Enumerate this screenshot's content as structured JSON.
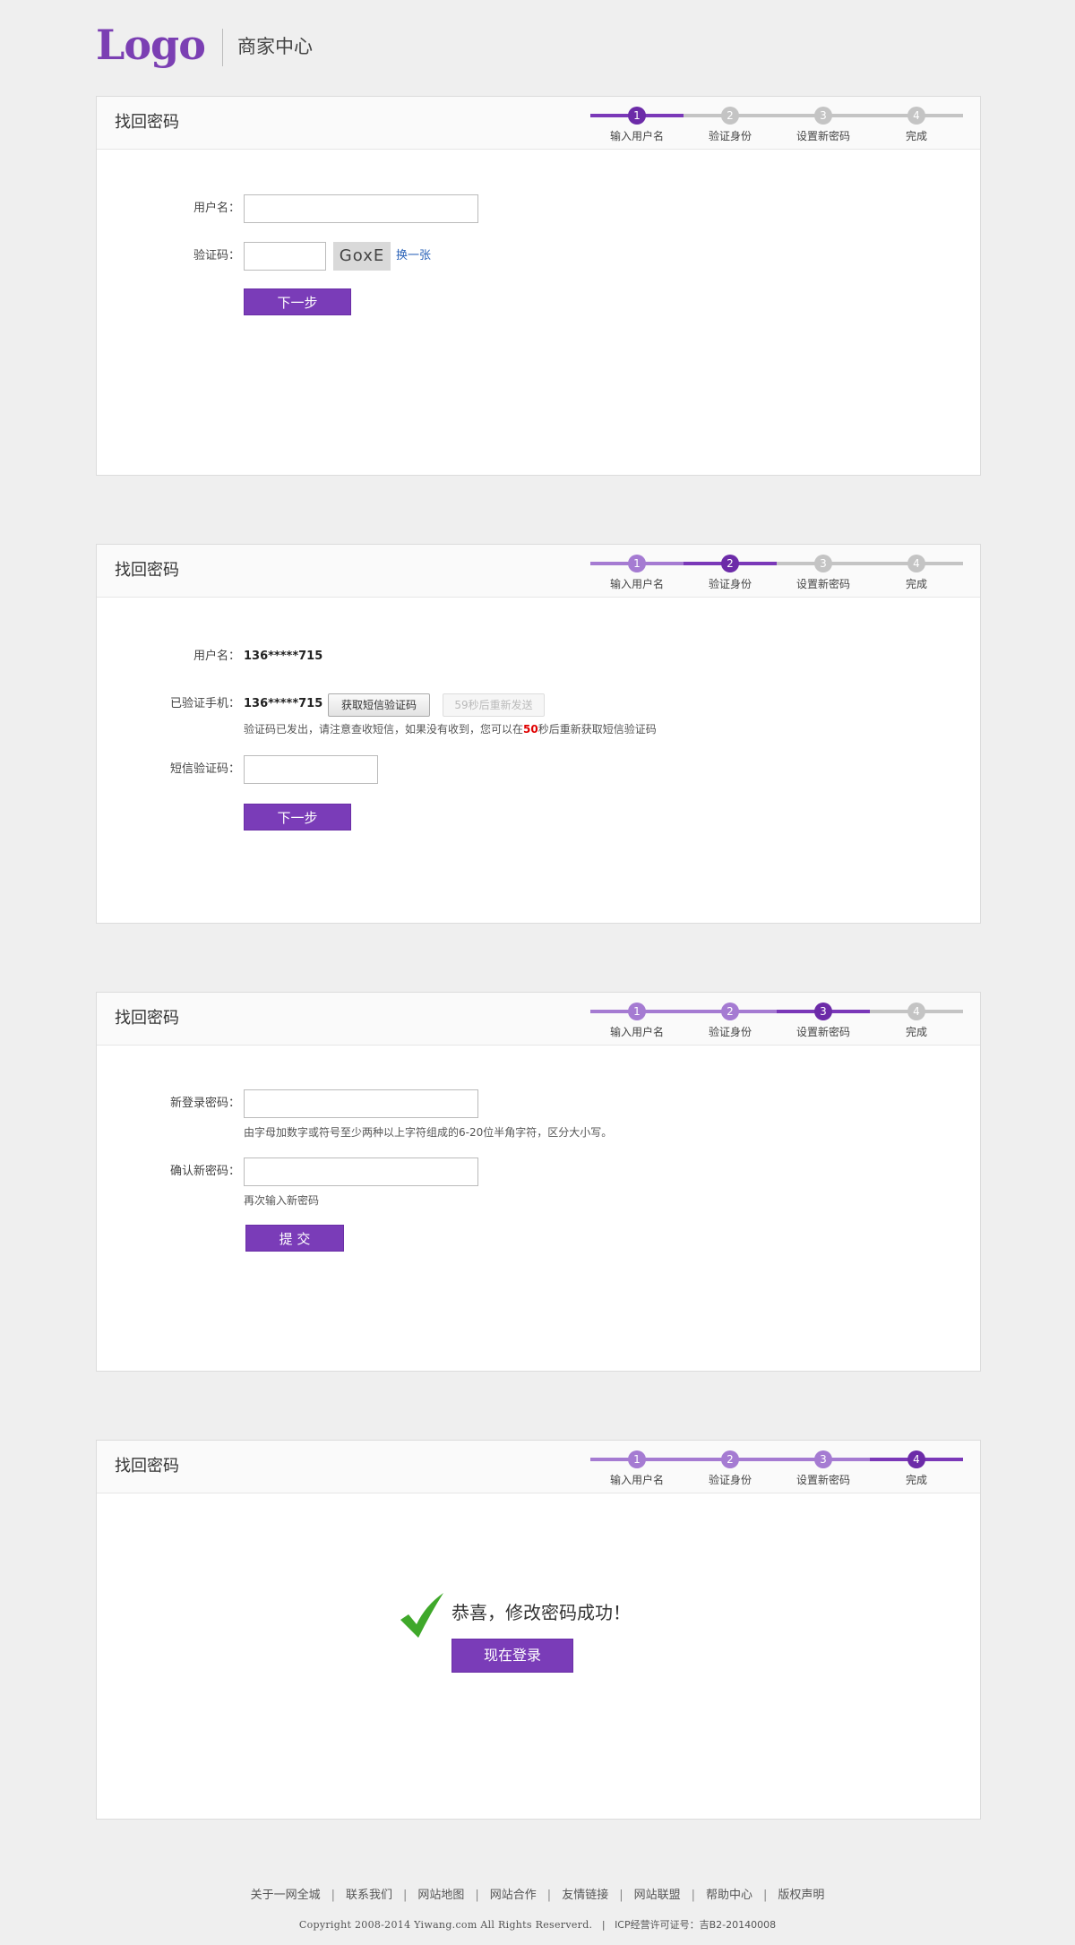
{
  "header": {
    "logo": "Logo",
    "subtitle": "商家中心"
  },
  "steps": {
    "labels": [
      "输入用户名",
      "验证身份",
      "设置新密码",
      "完成"
    ],
    "numbers": [
      "1",
      "2",
      "3",
      "4"
    ]
  },
  "panel_title": "找回密码",
  "panel1": {
    "username_label": "用户名：",
    "username_value": "",
    "captcha_label": "验证码：",
    "captcha_value": "",
    "captcha_text": "GoxE",
    "refresh_link": "换一张",
    "next_button": "下一步"
  },
  "panel2": {
    "username_label": "用户名：",
    "username_value": "136*****715",
    "phone_label": "已验证手机：",
    "phone_value": "136*****715",
    "get_code_button": "获取短信验证码",
    "resend_button": "59秒后重新发送",
    "hint_before": "验证码已发出，请注意查收短信，如果没有收到，您可以在",
    "hint_seconds": "50",
    "hint_after": "秒后重新获取短信验证码",
    "sms_label": "短信验证码：",
    "sms_value": "",
    "next_button": "下一步"
  },
  "panel3": {
    "new_password_label": "新登录密码：",
    "new_password_value": "",
    "new_password_hint": "由字母加数字或符号至少两种以上字符组成的6-20位半角字符，区分大小写。",
    "confirm_label": "确认新密码：",
    "confirm_value": "",
    "confirm_hint": "再次输入新密码",
    "submit_button": "提 交"
  },
  "panel4": {
    "success_text": "恭喜，修改密码成功！",
    "login_button": "现在登录"
  },
  "footer": {
    "links": [
      "关于一网全城",
      "联系我们",
      "网站地图",
      "网站合作",
      "友情链接",
      "网站联盟",
      "帮助中心",
      "版权声明"
    ],
    "copyright": "Copyright  2008-2014 Yiwang.com All Rights Reserverd.",
    "icp": "ICP经营许可证号：吉B2-20140008"
  },
  "colors": {
    "accent": "#7a3cb8",
    "step_done": "#a57bd2",
    "step_current": "#6c2ba8",
    "step_todo": "#c4c4c4",
    "success_green": "#3fa82a"
  }
}
